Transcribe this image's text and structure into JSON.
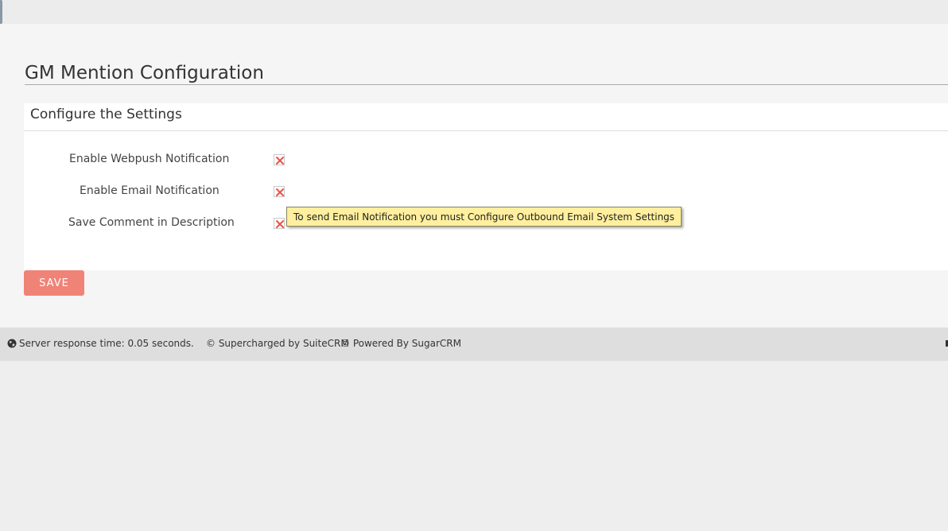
{
  "page": {
    "title": "GM Mention Configuration"
  },
  "panel": {
    "heading": "Configure the Settings",
    "rows": [
      {
        "label": "Enable Webpush Notification",
        "checked": false
      },
      {
        "label": "Enable Email Notification",
        "checked": false
      },
      {
        "label": "Save Comment in Description",
        "checked": false
      }
    ]
  },
  "tooltip": {
    "text": "To send Email Notification you must Configure Outbound Email System Settings"
  },
  "actions": {
    "save_label": "SAVE"
  },
  "footer": {
    "response_time": "Server response time: 0.05 seconds.",
    "supercharged": "© Supercharged by SuiteCRM",
    "powered": "© Powered By SugarCRM"
  },
  "icons": {
    "checkbox_mark": "x-mark-icon",
    "footer_left": "globe-icon"
  },
  "colors": {
    "accent": "#f08377",
    "x_mark": "#e8534a",
    "tooltip_bg": "#ffef9e"
  }
}
